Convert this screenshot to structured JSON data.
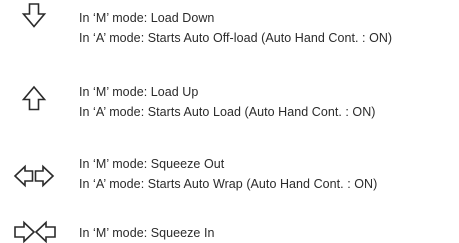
{
  "entries": [
    {
      "icon": "arrow-down-icon",
      "m_mode": "In ‘M’ mode: Load Down",
      "a_mode": "In ‘A’ mode: Starts Auto Off-load (Auto Hand Cont. : ON)"
    },
    {
      "icon": "arrow-up-icon",
      "m_mode": "In ‘M’ mode: Load Up",
      "a_mode": "In ‘A’ mode: Starts Auto Load (Auto Hand Cont. : ON)"
    },
    {
      "icon": "arrows-outward-icon",
      "m_mode": "In ‘M’ mode: Squeeze Out",
      "a_mode": "In ‘A’ mode: Starts Auto Wrap (Auto Hand Cont. : ON)"
    },
    {
      "icon": "arrows-inward-icon",
      "m_mode": "In ‘M’ mode: Squeeze In",
      "a_mode": ""
    }
  ]
}
